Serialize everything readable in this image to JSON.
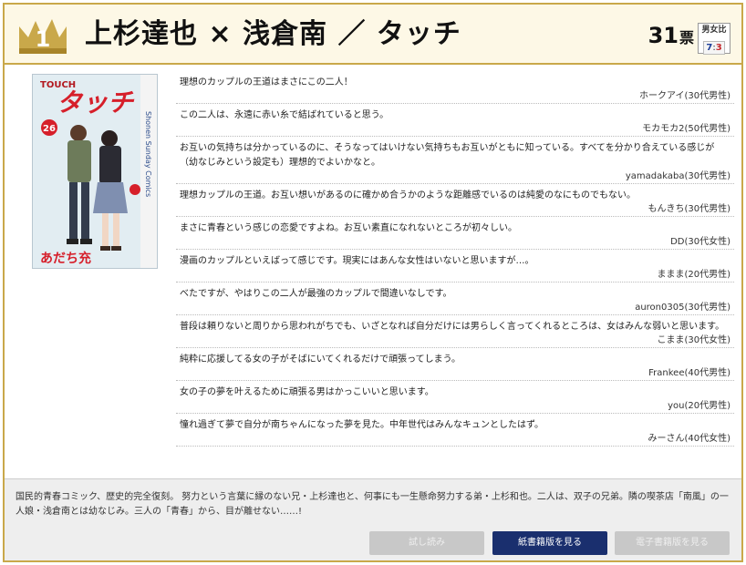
{
  "header": {
    "rank": "1",
    "title": "上杉達也 × 浅倉南 ／ タッチ",
    "votes": "31",
    "votes_unit": "票",
    "ratio_label": "男女比",
    "ratio_male": "7",
    "ratio_sep": ":",
    "ratio_female": "3"
  },
  "cover": {
    "series_en": "TOUCH",
    "title_jp": "タッチ",
    "volume": "26",
    "author": "あだち充",
    "spine_text": "Shonen Sunday Comics"
  },
  "comments": [
    {
      "text": "理想のカップルの王道はまさにこの二人！",
      "author": "ホークアイ(30代男性)"
    },
    {
      "text": "この二人は、永遠に赤い糸で結ばれていると思う。",
      "author": "モカモカ2(50代男性)"
    },
    {
      "text": "お互いの気持ちは分かっているのに、そうなってはいけない気持ちもお互いがともに知っている。すべてを分かり合えている感じが（幼なじみという設定も）理想的でよいかなと。",
      "author": "yamadakaba(30代男性)"
    },
    {
      "text": "理想カップルの王道。お互い想いがあるのに確かめ合うかのような距離感でいるのは純愛のなにものでもない。",
      "author": "もんきち(30代男性)"
    },
    {
      "text": "まさに青春という感じの恋愛ですよね。お互い素直になれないところが初々しい。",
      "author": "DD(30代女性)"
    },
    {
      "text": "漫画のカップルといえばって感じです。現実にはあんな女性はいないと思いますが…。",
      "author": "ままま(20代男性)"
    },
    {
      "text": "べたですが、やはりこの二人が最強のカップルで間違いなしです。",
      "author": "auron0305(30代男性)"
    },
    {
      "text": "普段は頼りないと周りから思われがちでも、いざとなれば自分だけには男らしく言ってくれるところは、女はみんな弱いと思います。",
      "author": "こまま(30代女性)"
    },
    {
      "text": "純粋に応援してる女の子がそばにいてくれるだけで頑張ってしまう。",
      "author": "Frankee(40代男性)"
    },
    {
      "text": "女の子の夢を叶えるために頑張る男はかっこいいと思います。",
      "author": "you(20代男性)"
    },
    {
      "text": "憧れ過ぎて夢で自分が南ちゃんになった夢を見た。中年世代はみんなキュンとしたはず。",
      "author": "みーさん(40代女性)"
    }
  ],
  "footer": {
    "description": "国民的青春コミック、歴史的完全復刻。 努力という言葉に縁のない兄・上杉達也と、何事にも一生懸命努力する弟・上杉和也。二人は、双子の兄弟。隣の喫茶店「南風」の一人娘・浅倉南とは幼なじみ。三人の「青春」から、目が離せない……!",
    "btn_trial": "試し読み",
    "btn_paper": "紙書籍版を見る",
    "btn_ebook": "電子書籍版を見る"
  },
  "colors": {
    "gold": "#c9a84a",
    "header_bg": "#fdf8e6",
    "primary_button": "#1a2f6e",
    "disabled_button": "#c8c8c8"
  }
}
